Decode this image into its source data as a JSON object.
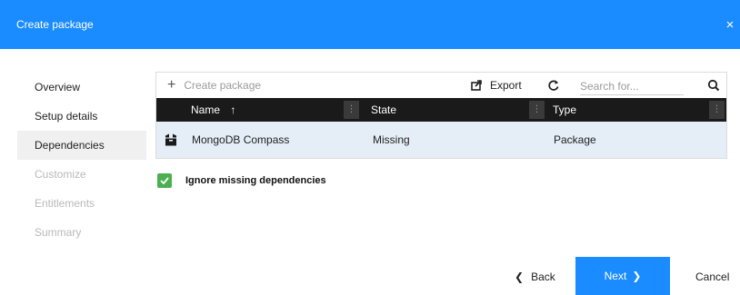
{
  "window": {
    "title": "Create package",
    "close_icon": "×"
  },
  "nav": {
    "items": [
      {
        "label": "Overview",
        "state": "normal"
      },
      {
        "label": "Setup details",
        "state": "normal"
      },
      {
        "label": "Dependencies",
        "state": "active"
      },
      {
        "label": "Customize",
        "state": "disabled"
      },
      {
        "label": "Entitlements",
        "state": "disabled"
      },
      {
        "label": "Summary",
        "state": "disabled"
      }
    ]
  },
  "toolbar": {
    "create_label": "Create package",
    "export_label": "Export",
    "search_placeholder": "Search for..."
  },
  "table": {
    "columns": [
      {
        "label": "Name",
        "sort": "↑"
      },
      {
        "label": "State"
      },
      {
        "label": "Type"
      }
    ],
    "rows": [
      {
        "icon": "package-icon",
        "name": "MongoDB Compass",
        "state": "Missing",
        "type": "Package"
      }
    ]
  },
  "options": {
    "ignore_missing_label": "Ignore missing dependencies",
    "ignore_missing_checked": true
  },
  "footer": {
    "back_label": "Back",
    "next_label": "Next",
    "cancel_label": "Cancel"
  },
  "colors": {
    "accent": "#1a8cff",
    "header_bg": "#1a1a1a",
    "selected_row": "#e5eef7",
    "checkbox": "#4caf50"
  }
}
